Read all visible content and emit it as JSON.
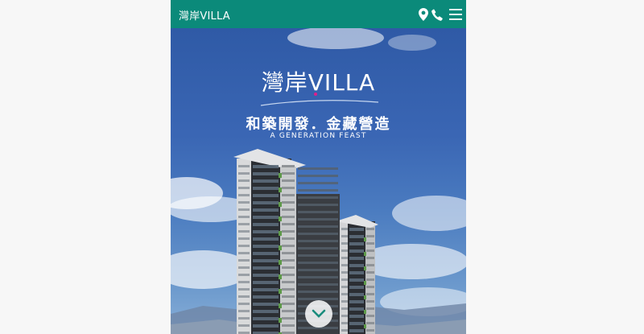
{
  "header": {
    "logo_text": "灣岸VILLA",
    "icons": [
      "map-pin-icon",
      "phone-icon",
      "menu-icon"
    ],
    "background_color": "#0b8a7a"
  },
  "hero": {
    "logo_text": "灣岸VILLA",
    "subtitle": "和築開發．金藏營造",
    "tagline": "A GENERATION FEAST",
    "accent_dot_color": "#e01d8a",
    "scroll_icon": "chevron-down-icon"
  }
}
